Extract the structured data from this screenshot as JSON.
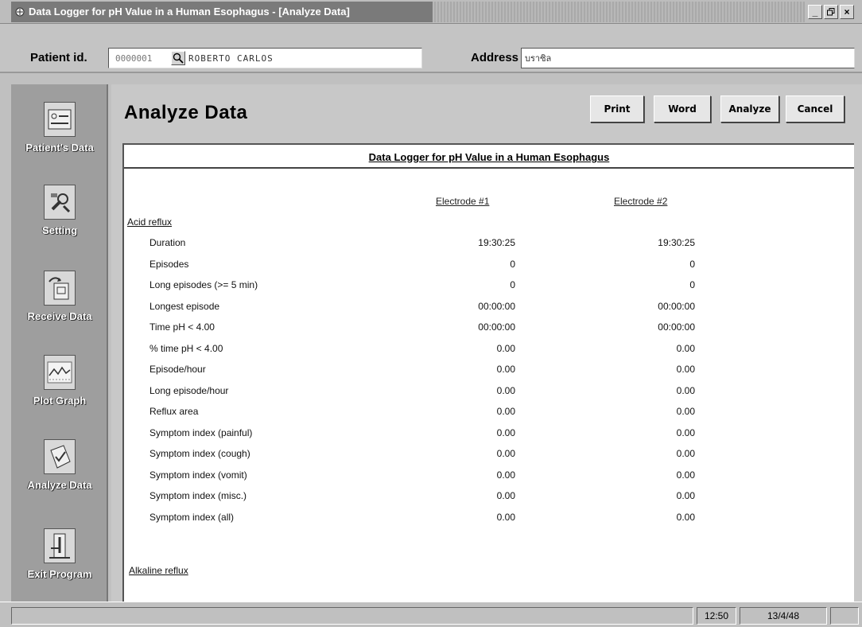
{
  "window": {
    "title": "Data Logger for pH Value in a Human Esophagus - [Analyze Data]",
    "minimize": "_",
    "maximize": "▫",
    "close": "×"
  },
  "patient": {
    "id_label": "Patient id.",
    "id_value": "0000001",
    "name": "ROBERTO CARLOS",
    "address_label": "Address",
    "address_value": "บราซิล"
  },
  "sidebar": {
    "items": [
      {
        "label": "Patient's Data",
        "icon": "patient-data-icon"
      },
      {
        "label": "Setting",
        "icon": "setting-icon"
      },
      {
        "label": "Receive Data",
        "icon": "receive-data-icon"
      },
      {
        "label": "Plot Graph",
        "icon": "plot-graph-icon"
      },
      {
        "label": "Analyze Data",
        "icon": "analyze-data-icon"
      },
      {
        "label": "Exit Program",
        "icon": "exit-program-icon"
      }
    ]
  },
  "main": {
    "title": "Analyze Data",
    "buttons": {
      "print": "Print",
      "word": "Word",
      "analyze": "Analyze",
      "cancel": "Cancel"
    }
  },
  "report": {
    "title": "Data Logger for pH Value in a Human Esophagus",
    "col1": "Electrode #1",
    "col2": "Electrode #2",
    "acid_section": "Acid reflux",
    "alkaline_section": "Alkaline reflux",
    "rows": [
      {
        "label": "Duration",
        "e1": "19:30:25",
        "e2": "19:30:25"
      },
      {
        "label": "Episodes",
        "e1": "0",
        "e2": "0"
      },
      {
        "label": "Long episodes (>= 5 min)",
        "e1": "0",
        "e2": "0"
      },
      {
        "label": "Longest episode",
        "e1": "00:00:00",
        "e2": "00:00:00"
      },
      {
        "label": "Time pH < 4.00",
        "e1": "00:00:00",
        "e2": "00:00:00"
      },
      {
        "label": "% time pH < 4.00",
        "e1": "0.00",
        "e2": "0.00"
      },
      {
        "label": "Episode/hour",
        "e1": "0.00",
        "e2": "0.00"
      },
      {
        "label": "Long episode/hour",
        "e1": "0.00",
        "e2": "0.00"
      },
      {
        "label": "Reflux area",
        "e1": "0.00",
        "e2": "0.00"
      },
      {
        "label": "Symptom index (painful)",
        "e1": "0.00",
        "e2": "0.00"
      },
      {
        "label": "Symptom index (cough)",
        "e1": "0.00",
        "e2": "0.00"
      },
      {
        "label": "Symptom index (vomit)",
        "e1": "0.00",
        "e2": "0.00"
      },
      {
        "label": "Symptom index (misc.)",
        "e1": "0.00",
        "e2": "0.00"
      },
      {
        "label": "Symptom index (all)",
        "e1": "0.00",
        "e2": "0.00"
      }
    ]
  },
  "status": {
    "time": "12:50",
    "date": "13/4/48"
  }
}
